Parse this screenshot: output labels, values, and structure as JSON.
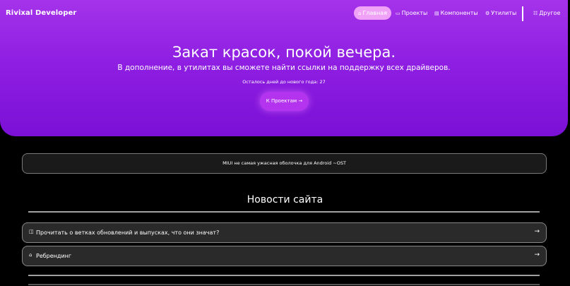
{
  "brand": "Rivixal Developer",
  "nav": {
    "items": [
      {
        "icon": "⌂",
        "label": "Главная",
        "active": true
      },
      {
        "icon": "▭",
        "label": "Проекты",
        "active": false
      },
      {
        "icon": "▤",
        "label": "Компоненты",
        "active": false
      },
      {
        "icon": "⚙",
        "label": "Утилиты",
        "active": false
      }
    ],
    "more": {
      "icon": "☷",
      "label": "Другое"
    }
  },
  "hero": {
    "title": "Закат красок, покой вечера.",
    "subtitle": "В дополнение, в утилитах вы сможете найти ссылки на поддержку всех драйверов.",
    "countdown": "Осталось дней до нового года: 27",
    "cta": "К Проектам →"
  },
  "notice": "MIUI не самая ужасная оболочка для Android ~OST",
  "news": {
    "title": "Новости сайта",
    "items": [
      {
        "icon": "◫",
        "label": "Прочитать о ветках обновлений и выпусках, что они значат?",
        "arrow": "→"
      },
      {
        "icon": "⌂",
        "label": "Ребрендинг",
        "arrow": "→"
      }
    ]
  },
  "colors": {
    "accent": "#8f1fe2",
    "active_pill": "#f0a2f7",
    "cta": "#b333ef"
  }
}
